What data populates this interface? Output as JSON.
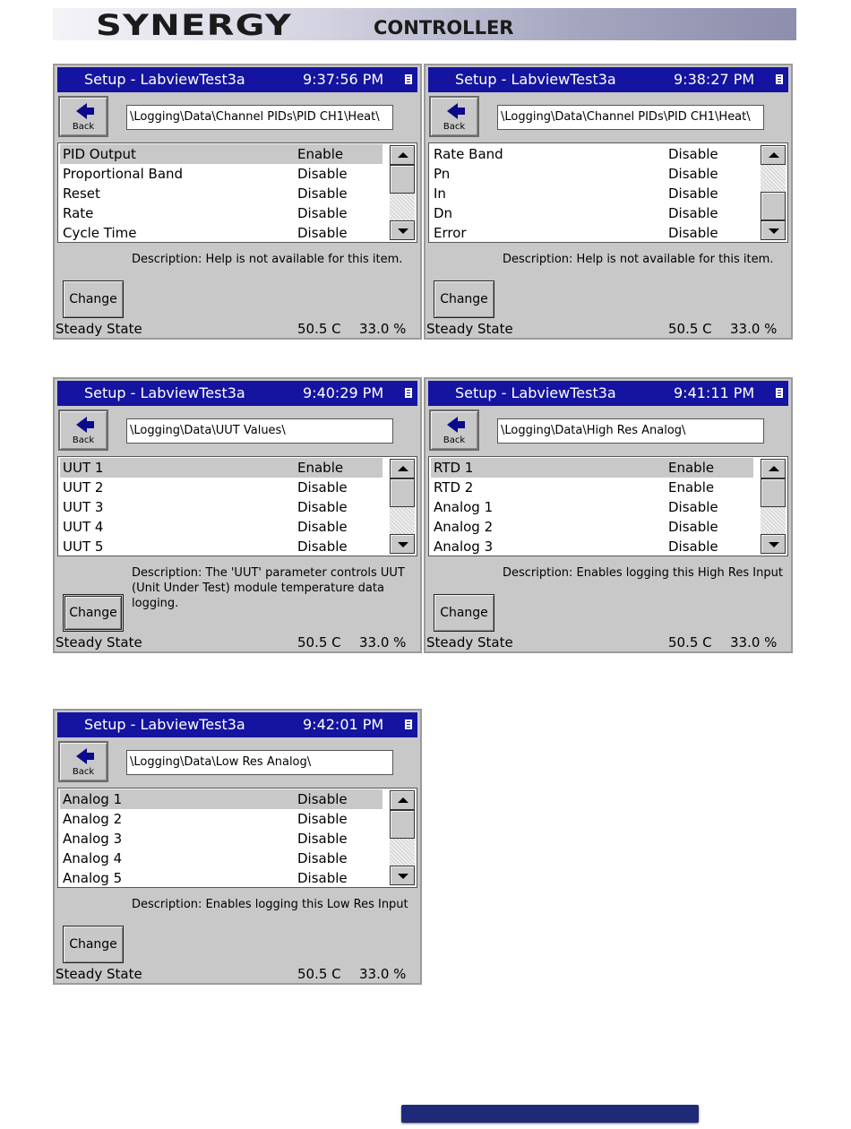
{
  "header": {
    "brand": "SYNERGY",
    "subtitle": "CONTROLLER"
  },
  "panels": [
    {
      "title": "Setup - LabviewTest3a",
      "time": "9:37:56 PM",
      "back_label": "Back",
      "path": "\\Logging\\Data\\Channel PIDs\\PID CH1\\Heat\\",
      "rows": [
        {
          "name": "PID Output",
          "state": "Enable"
        },
        {
          "name": "Proportional Band",
          "state": "Disable"
        },
        {
          "name": "Reset",
          "state": "Disable"
        },
        {
          "name": "Rate",
          "state": "Disable"
        },
        {
          "name": "Cycle Time",
          "state": "Disable"
        }
      ],
      "description": "Description:  Help is not available for this item.",
      "change_label": "Change",
      "status": "Steady State",
      "temp": "50.5 C",
      "percent": "33.0 %"
    },
    {
      "title": "Setup - LabviewTest3a",
      "time": "9:38:27 PM",
      "back_label": "Back",
      "path": "\\Logging\\Data\\Channel PIDs\\PID CH1\\Heat\\",
      "rows": [
        {
          "name": "Rate Band",
          "state": "Disable"
        },
        {
          "name": "Pn",
          "state": "Disable"
        },
        {
          "name": "In",
          "state": "Disable"
        },
        {
          "name": "Dn",
          "state": "Disable"
        },
        {
          "name": "Error",
          "state": "Disable"
        }
      ],
      "description": "Description:  Help is not available for this item.",
      "change_label": "Change",
      "status": "Steady State",
      "temp": "50.5 C",
      "percent": "33.0 %"
    },
    {
      "title": "Setup - LabviewTest3a",
      "time": "9:40:29 PM",
      "back_label": "Back",
      "path": "\\Logging\\Data\\UUT Values\\",
      "rows": [
        {
          "name": "UUT 1",
          "state": "Enable"
        },
        {
          "name": "UUT 2",
          "state": "Disable"
        },
        {
          "name": "UUT 3",
          "state": "Disable"
        },
        {
          "name": "UUT 4",
          "state": "Disable"
        },
        {
          "name": "UUT 5",
          "state": "Disable"
        }
      ],
      "description": "Description:  The 'UUT' parameter controls UUT (Unit Under Test) module temperature data logging.",
      "change_label": "Change",
      "status": "Steady State",
      "temp": "50.5 C",
      "percent": "33.0 %"
    },
    {
      "title": "Setup - LabviewTest3a",
      "time": "9:41:11 PM",
      "back_label": "Back",
      "path": "\\Logging\\Data\\High Res Analog\\",
      "rows": [
        {
          "name": "RTD 1",
          "state": "Enable"
        },
        {
          "name": "RTD 2",
          "state": "Enable"
        },
        {
          "name": "Analog 1",
          "state": "Disable"
        },
        {
          "name": "Analog 2",
          "state": "Disable"
        },
        {
          "name": "Analog 3",
          "state": "Disable"
        }
      ],
      "description": "Description:  Enables logging this High Res Input",
      "change_label": "Change",
      "status": "Steady State",
      "temp": "50.5 C",
      "percent": "33.0 %"
    },
    {
      "title": "Setup - LabviewTest3a",
      "time": "9:42:01 PM",
      "back_label": "Back",
      "path": "\\Logging\\Data\\Low Res Analog\\",
      "rows": [
        {
          "name": "Analog 1",
          "state": "Disable"
        },
        {
          "name": "Analog 2",
          "state": "Disable"
        },
        {
          "name": "Analog 3",
          "state": "Disable"
        },
        {
          "name": "Analog 4",
          "state": "Disable"
        },
        {
          "name": "Analog 5",
          "state": "Disable"
        }
      ],
      "description": "Description:  Enables logging this Low Res Input",
      "change_label": "Change",
      "status": "Steady State",
      "temp": "50.5 C",
      "percent": "33.0 %"
    }
  ],
  "colors": {
    "titlebar": "#1414a0",
    "panel_bg": "#c8c8c8",
    "accent_bar": "#1e2a78"
  }
}
